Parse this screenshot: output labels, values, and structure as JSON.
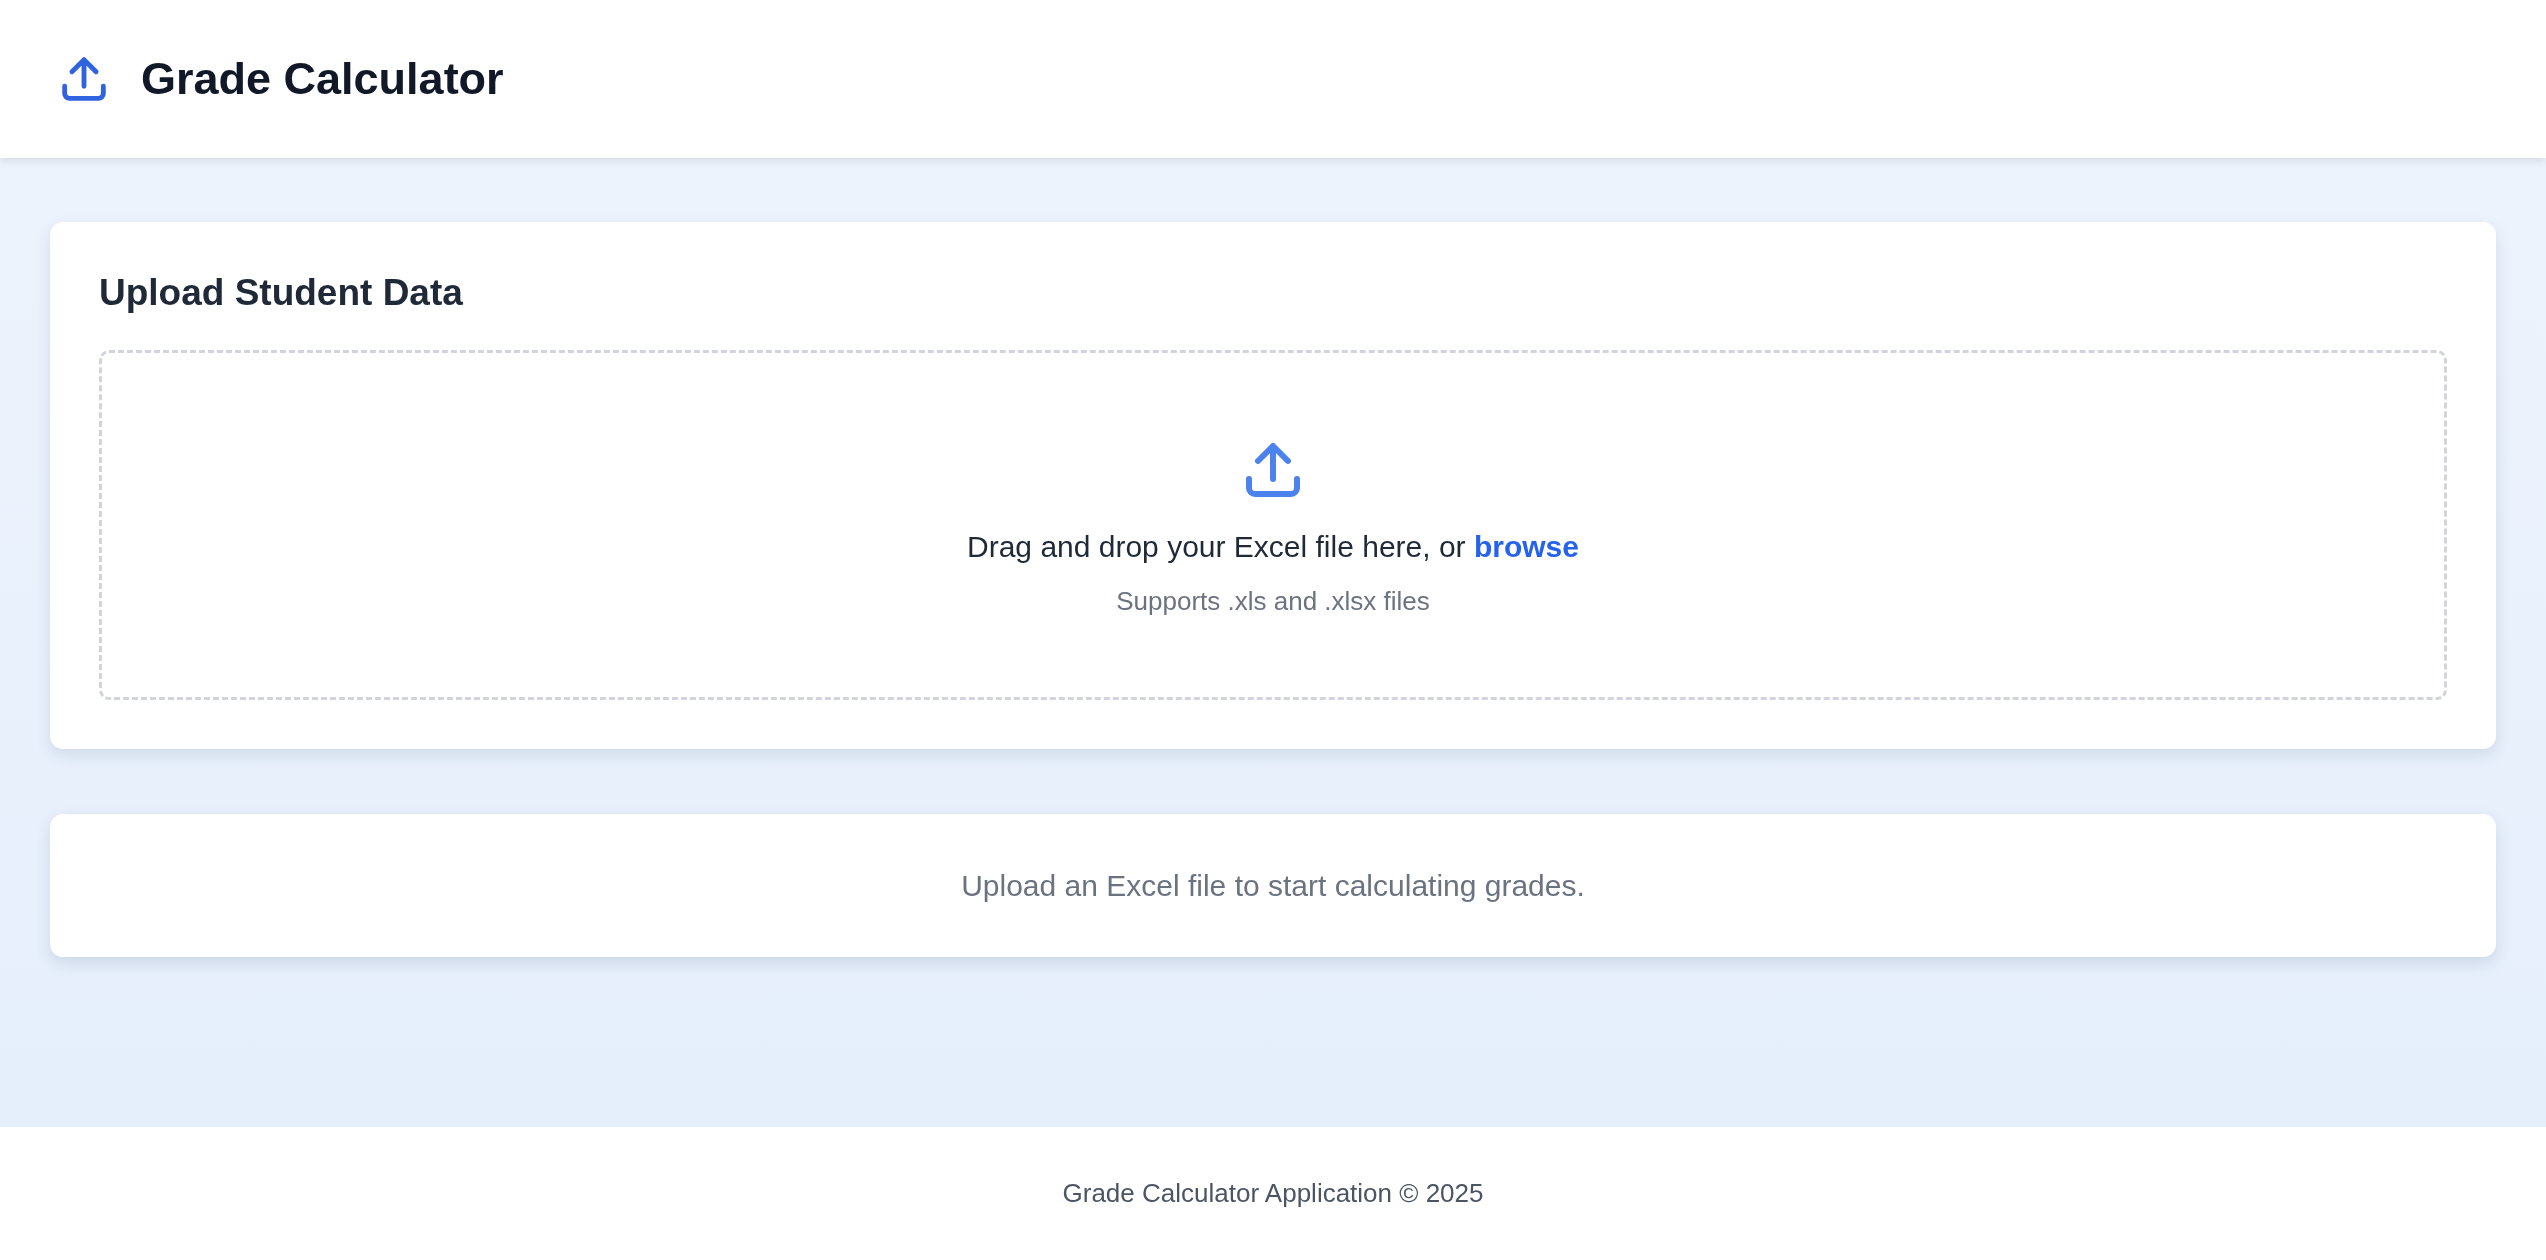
{
  "header": {
    "title": "Grade Calculator"
  },
  "upload_card": {
    "title": "Upload Student Data",
    "prompt": "Drag and drop your Excel file here, or",
    "link": "browse",
    "hint": "Supports .xls and .xlsx files"
  },
  "status_card": {
    "message": "Upload an Excel file to start calculating grades."
  },
  "footer": {
    "text": "Grade Calculator Application © 2025"
  }
}
